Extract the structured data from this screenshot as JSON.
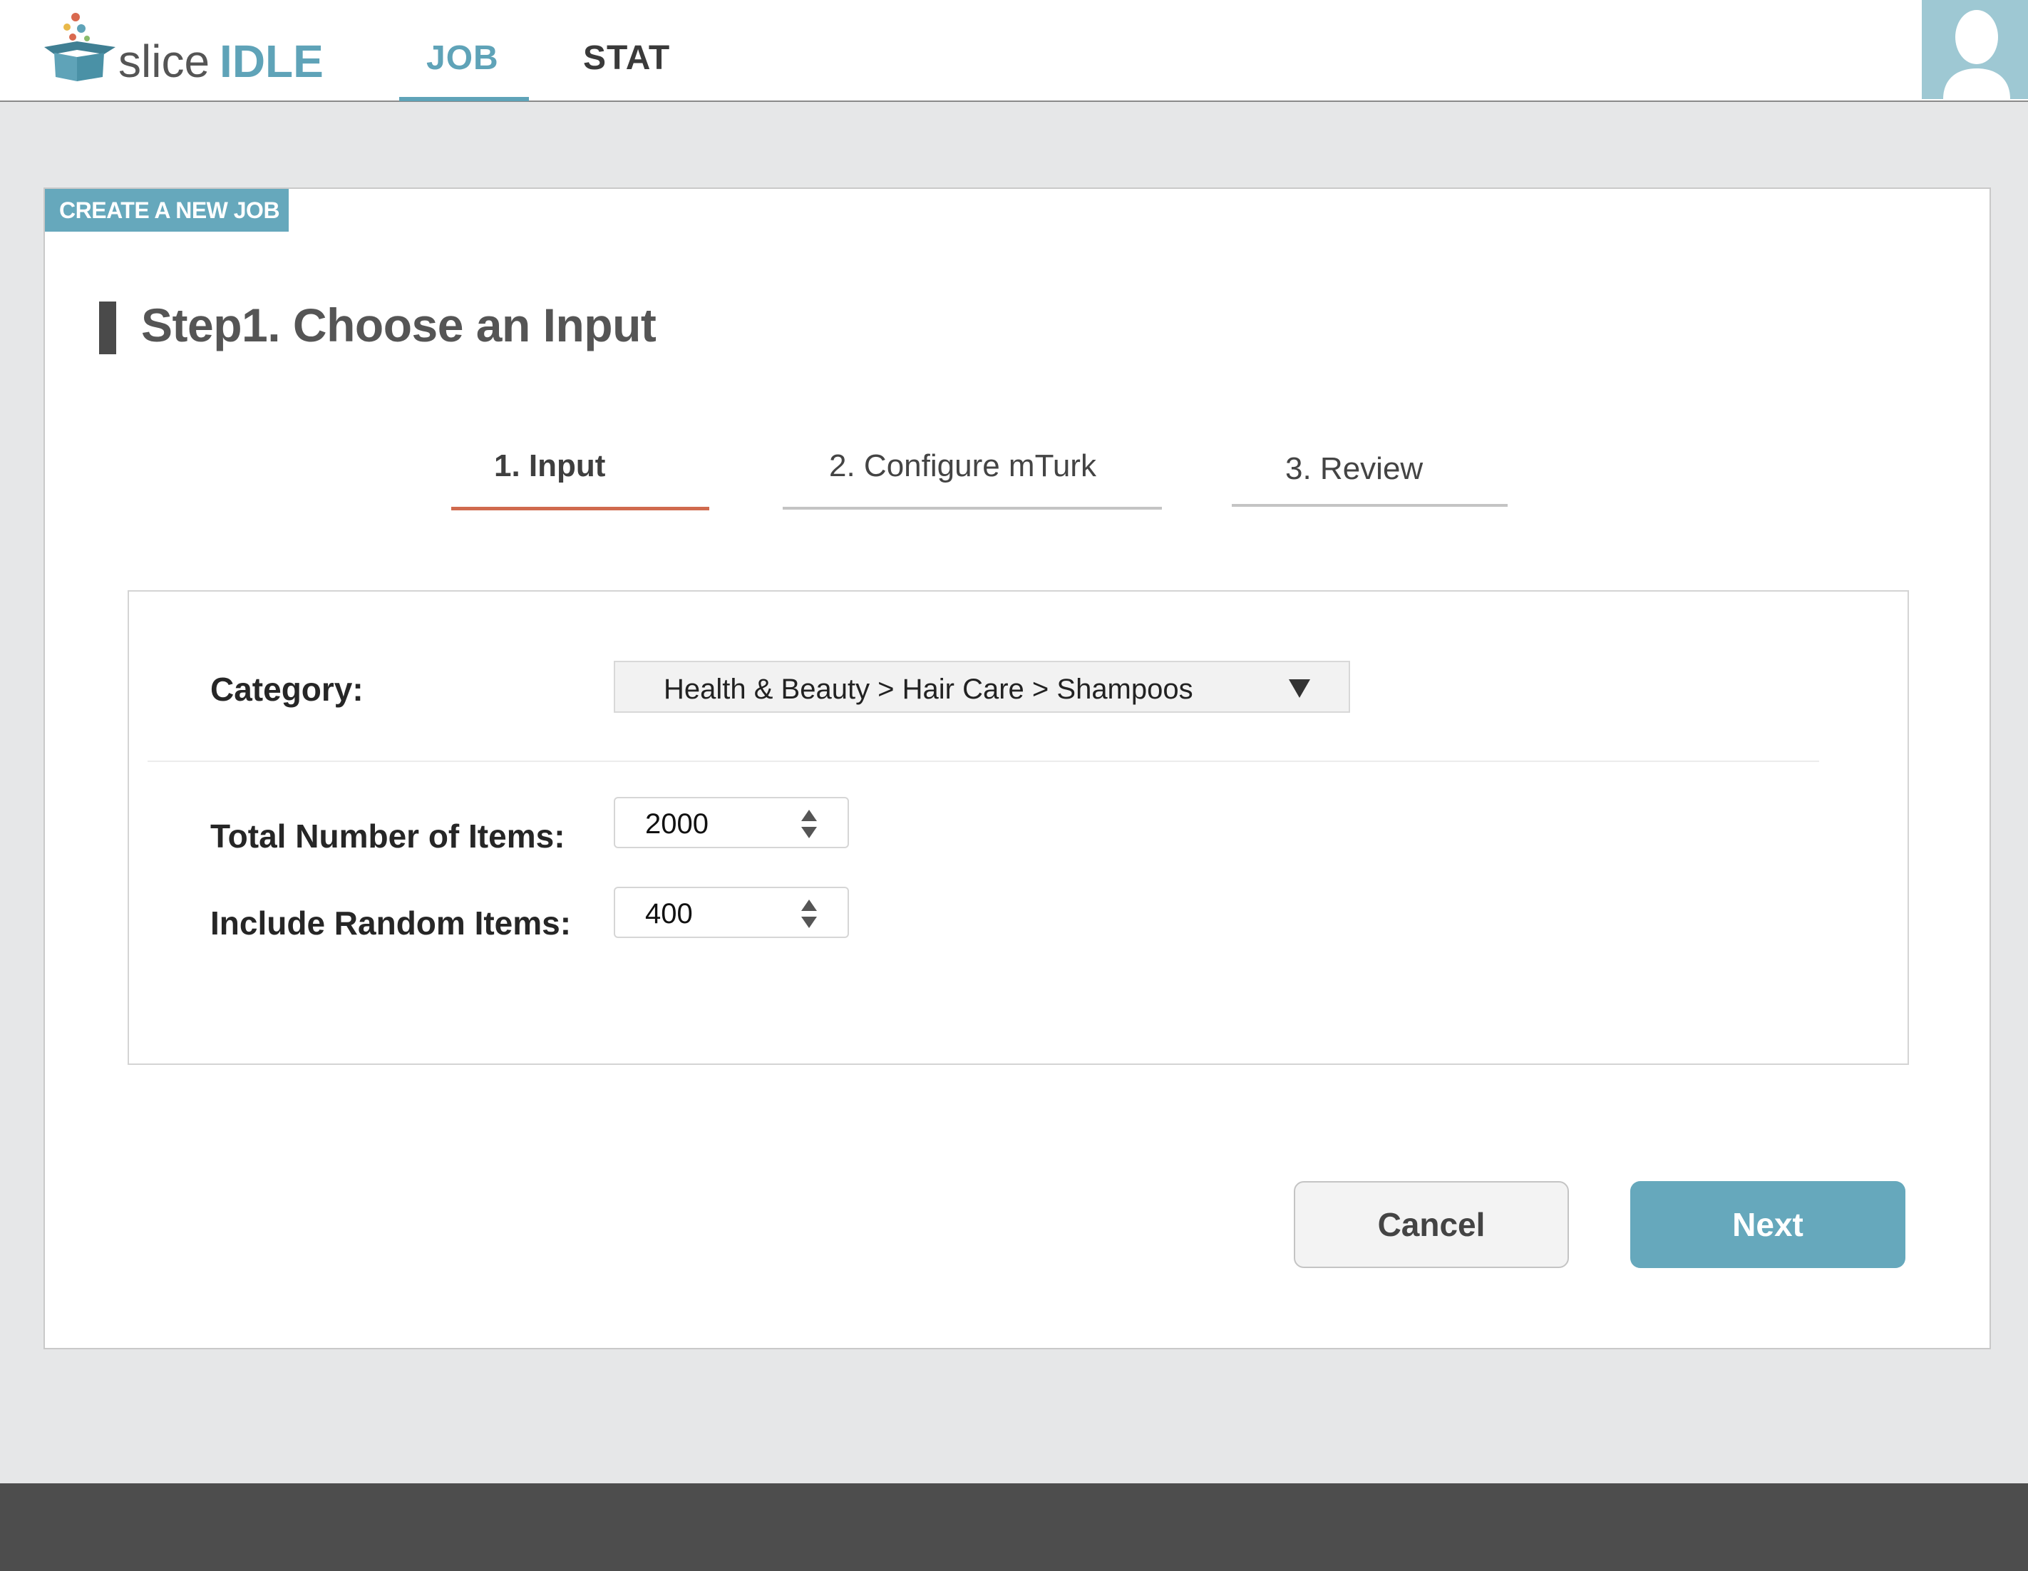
{
  "app": {
    "logo_word": "slice",
    "logo_accent": "IDLE"
  },
  "nav": {
    "tabs": [
      {
        "label": "JOB",
        "active": true
      },
      {
        "label": "STAT",
        "active": false
      }
    ]
  },
  "card": {
    "tag": "CREATE A NEW JOB",
    "step_title": "Step1. Choose an Input"
  },
  "wizard": {
    "steps": [
      {
        "label": "1. Input",
        "active": true
      },
      {
        "label": "2.  Configure mTurk",
        "active": false
      },
      {
        "label": "3. Review",
        "active": false
      }
    ]
  },
  "form": {
    "category": {
      "label": "Category:",
      "value": "Health & Beauty > Hair Care > Shampoos"
    },
    "total_items": {
      "label": "Total Number of Items:",
      "value": "2000"
    },
    "random_items": {
      "label": "Include Random Items:",
      "value": "400"
    }
  },
  "actions": {
    "cancel": "Cancel",
    "next": "Next"
  },
  "colors": {
    "accent": "#66a8bc",
    "active_step": "#d06a4e",
    "footer": "#4d4d4d"
  },
  "icons": [
    "logo-box-icon",
    "user-avatar-icon",
    "dropdown-arrow-icon",
    "stepper-arrows-icon"
  ]
}
